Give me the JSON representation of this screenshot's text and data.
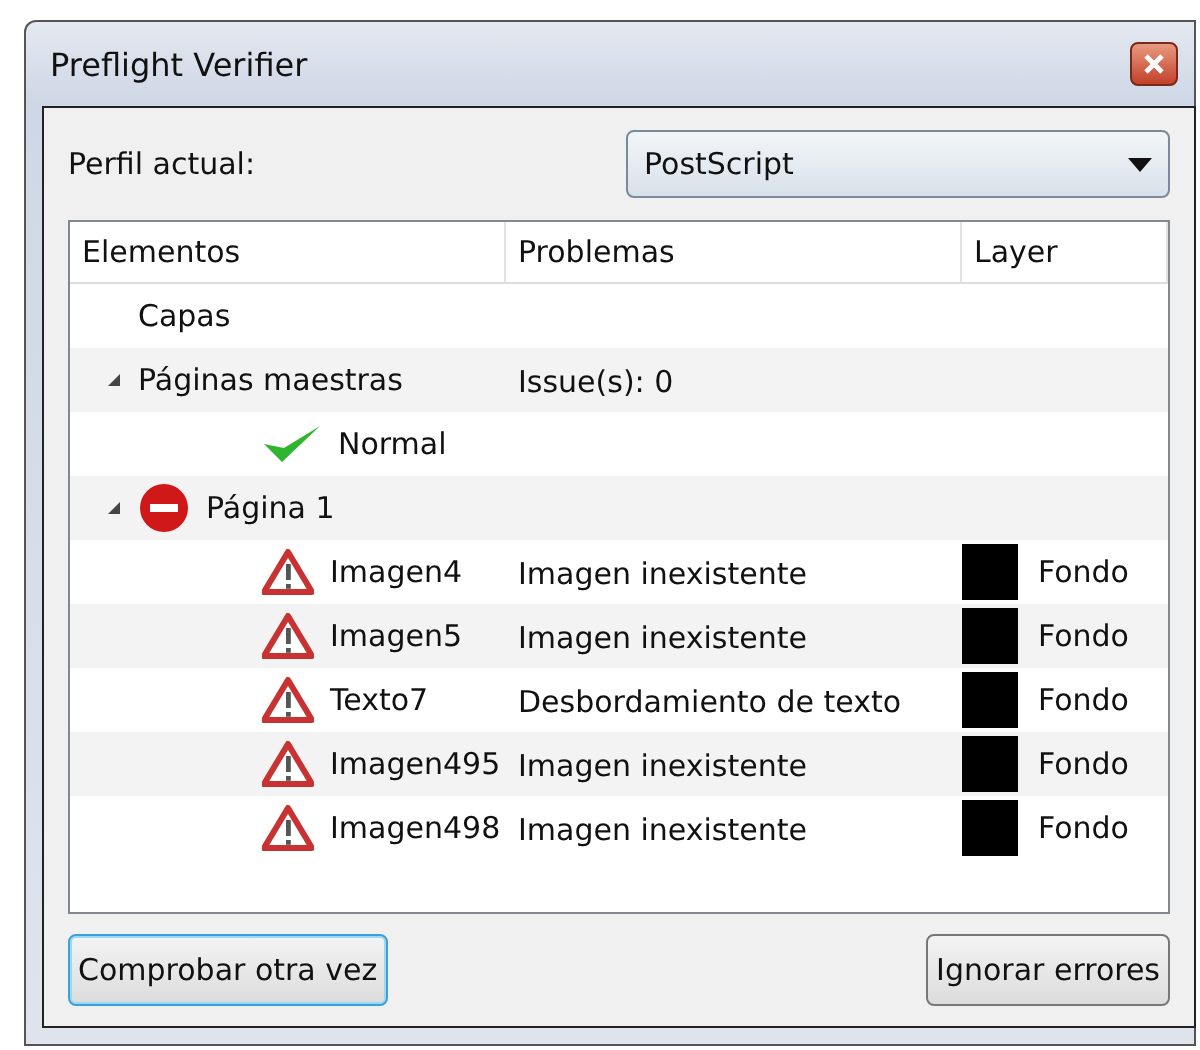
{
  "window": {
    "title": "Preflight Verifier"
  },
  "profile": {
    "label": "Perfil actual:",
    "value": "PostScript"
  },
  "table": {
    "columns": [
      "Elementos",
      "Problemas",
      "Layer"
    ],
    "rows": [
      {
        "name": "Capas"
      },
      {
        "name": "Páginas maestras",
        "problem": "Issue(s): 0",
        "expanded": true,
        "children": [
          {
            "name": "Normal",
            "kind": "ok"
          }
        ]
      },
      {
        "name": "Página 1",
        "kind": "error",
        "expanded": true,
        "children": [
          {
            "name": "Imagen4",
            "kind": "warning",
            "problem": "Imagen inexistente",
            "layer": {
              "name": "Fondo",
              "color": "#000000"
            }
          },
          {
            "name": "Imagen5",
            "kind": "warning",
            "problem": "Imagen inexistente",
            "layer": {
              "name": "Fondo",
              "color": "#000000"
            }
          },
          {
            "name": "Texto7",
            "kind": "warning",
            "problem": "Desbordamiento de texto",
            "layer": {
              "name": "Fondo",
              "color": "#000000"
            }
          },
          {
            "name": "Imagen495",
            "kind": "warning",
            "problem": "Imagen inexistente",
            "layer": {
              "name": "Fondo",
              "color": "#000000"
            }
          },
          {
            "name": "Imagen498",
            "kind": "warning",
            "problem": "Imagen inexistente",
            "layer": {
              "name": "Fondo",
              "color": "#000000"
            }
          }
        ]
      }
    ]
  },
  "buttons": [
    {
      "label": "Comprobar otra vez",
      "focused": true
    },
    {
      "label": "Ignorar errores",
      "focused": false
    }
  ]
}
